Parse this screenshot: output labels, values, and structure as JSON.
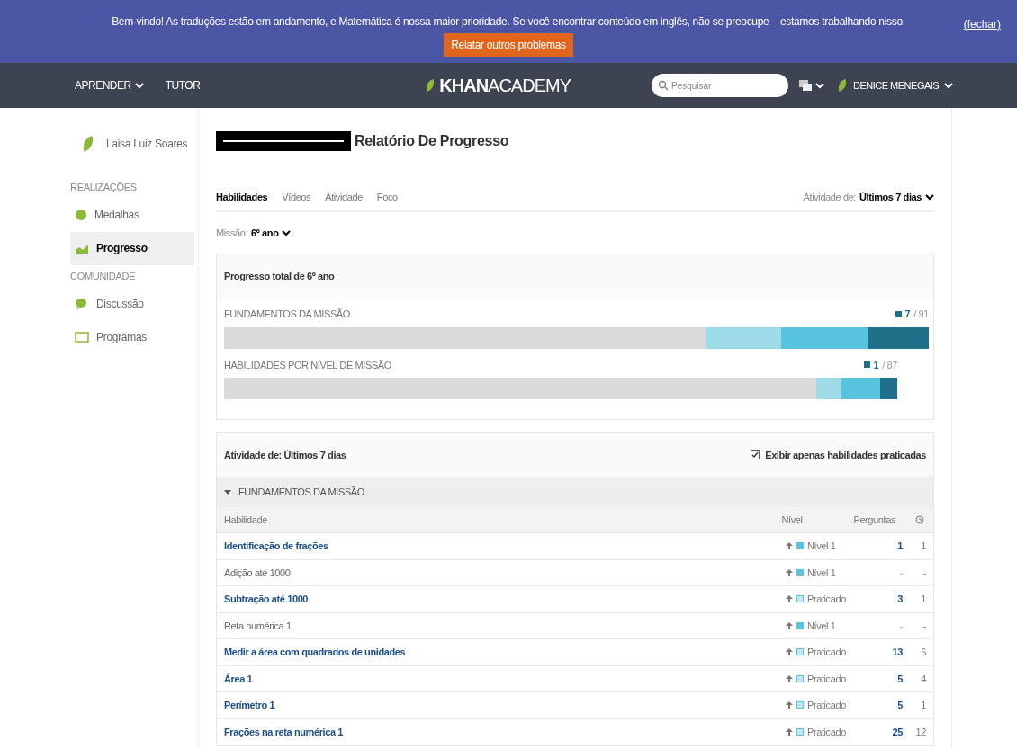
{
  "banner": {
    "message": "Bem-vindo! As traduções estão em andamento, e Matemática é nossa maior prioridade. Se você encontrar conteúdo em inglês, não se preocupe – estamos trabalhando nisso.",
    "close": "(fechar)",
    "button": "Relatar outros problemas"
  },
  "nav": {
    "items": [
      "APRENDER",
      "TUTOR"
    ],
    "logo_bold": "KHAN",
    "logo_light": "ACADEMY",
    "search": {
      "placeholder": "Pesquisar"
    },
    "user": "DENICE MENEGAIS"
  },
  "sidebar": {
    "student": "Laisa Luiz Soares",
    "sections": [
      {
        "title": "REALIZAÇÕES",
        "items": [
          {
            "label": "Medalhas",
            "selected": false
          },
          {
            "label": "Progresso",
            "selected": true
          }
        ]
      },
      {
        "title": "COMUNIDADE",
        "items": [
          {
            "label": "Discussão",
            "selected": false
          },
          {
            "label": "Programas",
            "selected": false
          }
        ]
      }
    ]
  },
  "report": {
    "title": "Relatório De Progresso",
    "tabs": [
      {
        "label": "Habilidades",
        "selected": true
      },
      {
        "label": "Vídeos",
        "selected": false
      },
      {
        "label": "Atividade",
        "selected": false
      },
      {
        "label": "Foco",
        "selected": false
      }
    ],
    "activity_label": "Atividade de:",
    "activity_value": "Últimos 7 dias",
    "mission_label": "Missão:",
    "mission_value": "6º ano",
    "progress": {
      "title": "Progresso total de 6º ano",
      "bars": [
        {
          "label": "FUNDAMENTOS DA MISSÃO",
          "count": "7",
          "total": "/ 91",
          "segments": [
            {
              "color": "#9edbe8"
            },
            {
              "color": "#58c3df"
            },
            {
              "color": "#1f7088"
            }
          ]
        },
        {
          "label": "HABILIDADES POR NÍVEL DE MISSÃO",
          "count": "1",
          "total": "/ 87",
          "segments": [
            {
              "color": "#9edbe8"
            },
            {
              "color": "#58c3df"
            },
            {
              "color": "#1f7088"
            }
          ]
        }
      ]
    },
    "activity": {
      "title": "Atividade de: Últimos 7 dias",
      "filter": {
        "label": "Exibir apenas habilidades praticadas",
        "checked": true
      },
      "group": {
        "label": "FUNDAMENTOS DA MISSÃO",
        "expanded": true
      },
      "columns": [
        "Habilidade",
        "Nível",
        "Perguntas"
      ],
      "rows": [
        {
          "skill": "Identificação de frações",
          "kind": "link",
          "level": "Nível 1",
          "color": "#58c3df",
          "questions": "1",
          "time": "1"
        },
        {
          "skill": "Adição até 1000",
          "kind": "plain",
          "level": "Nível 1",
          "color": "#58c3df",
          "questions": "-",
          "time": "-"
        },
        {
          "skill": "Subtração até 1000",
          "kind": "link",
          "level": "Praticado",
          "color": "#bfe9f2",
          "questions": "3",
          "time": "1"
        },
        {
          "skill": "Reta numérica 1",
          "kind": "plain",
          "level": "Nível 1",
          "color": "#58c3df",
          "questions": "-",
          "time": "-"
        },
        {
          "skill": "Medir a área com quadrados de unidades",
          "kind": "link",
          "level": "Praticado",
          "color": "#bfe9f2",
          "questions": "13",
          "time": "6"
        },
        {
          "skill": "Área 1",
          "kind": "link",
          "level": "Praticado",
          "color": "#bfe9f2",
          "questions": "5",
          "time": "4"
        },
        {
          "skill": "Perímetro 1",
          "kind": "link",
          "level": "Praticado",
          "color": "#bfe9f2",
          "questions": "5",
          "time": "1"
        },
        {
          "skill": "Frações na reta numérica 1",
          "kind": "link",
          "level": "Praticado",
          "color": "#bfe9f2",
          "questions": "25",
          "time": "12"
        }
      ]
    }
  }
}
